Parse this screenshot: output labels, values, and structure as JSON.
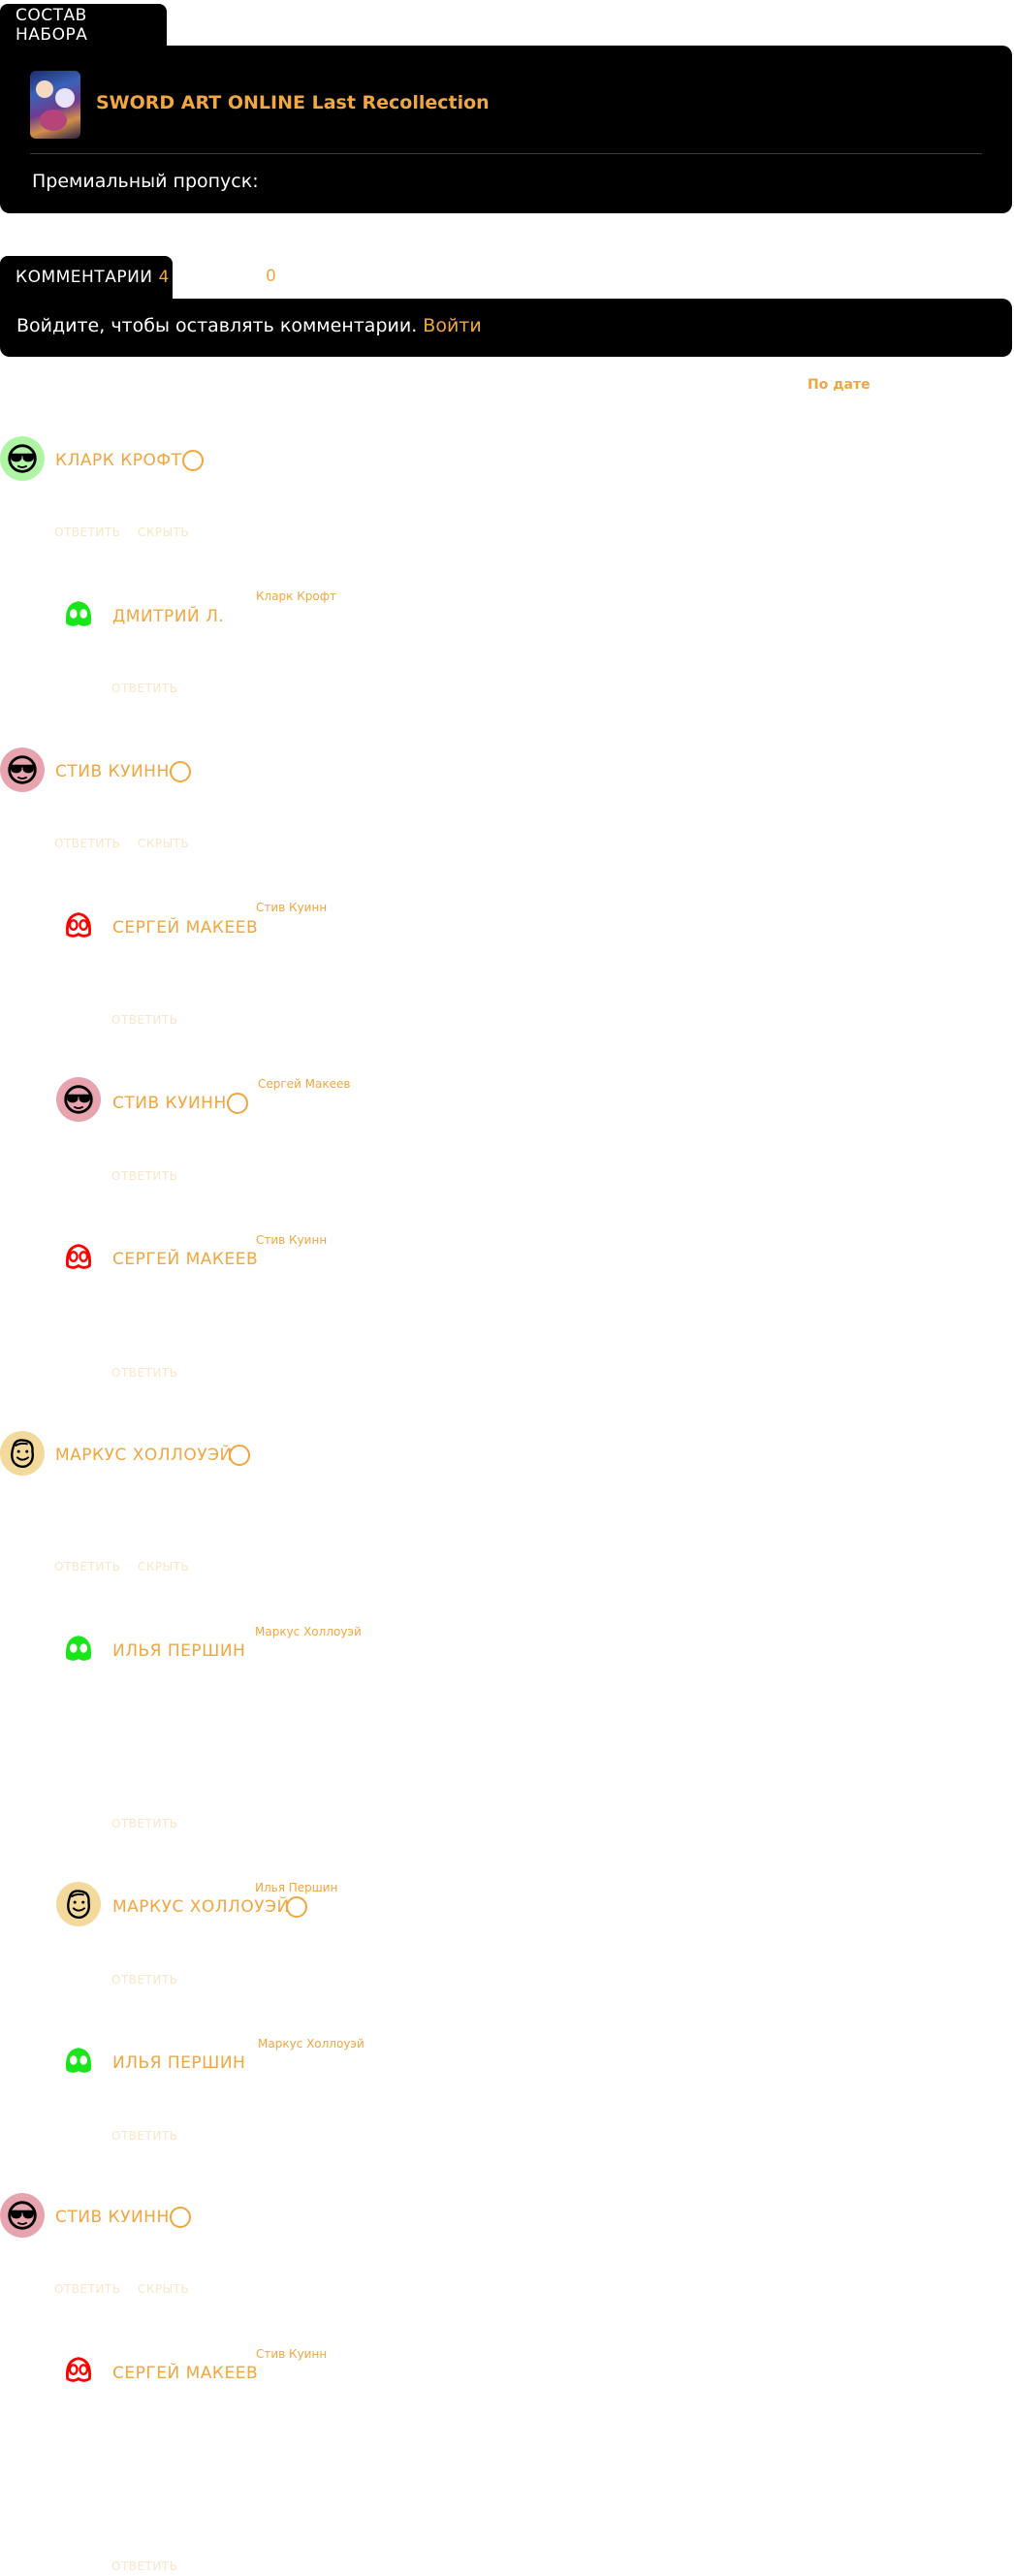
{
  "set": {
    "tab_label": "СОСТАВ НАБОРА",
    "game_title": "SWORD ART ONLINE Last Recollection",
    "premium_label": "Премиальный пропуск:"
  },
  "comments_section": {
    "tab_label": "КОММЕНТАРИИ",
    "count": "4",
    "likes": "0",
    "login_prompt": "Войдите, чтобы оставлять комментарии.",
    "login_link": "Войти",
    "sort_label": "По дате"
  },
  "actions": {
    "reply": "ОТВЕТИТЬ",
    "hide": "СКРЫТЬ"
  },
  "comments": [
    {
      "author": "КЛАРК КРОФТ"
    },
    {
      "author": "ДМИТРИЙ Л.",
      "reply_to": "Кларк Крофт"
    },
    {
      "author": "СТИВ КУИНН"
    },
    {
      "author": "СЕРГЕЙ МАКЕЕВ",
      "reply_to": "Стив Куинн"
    },
    {
      "author": "СТИВ КУИНН",
      "reply_to": "Сергей Макеев"
    },
    {
      "author": "СЕРГЕЙ МАКЕЕВ",
      "reply_to": "Стив Куинн"
    },
    {
      "author": "МАРКУС ХОЛЛОУЭЙ"
    },
    {
      "author": "ИЛЬЯ ПЕРШИН",
      "reply_to": "Маркус Холлоуэй"
    },
    {
      "author": "МАРКУС ХОЛЛОУЭЙ",
      "reply_to": "Илья Першин"
    },
    {
      "author": "ИЛЬЯ ПЕРШИН",
      "reply_to": "Маркус Холлоуэй"
    },
    {
      "author": "СТИВ КУИНН"
    },
    {
      "author": "СЕРГЕЙ МАКЕЕВ",
      "reply_to": "Стив Куинн"
    }
  ],
  "avatar_icons": {
    "steve": "sunglasses-face-icon",
    "sergey": "red-mask-face-icon",
    "green": "green-mask-face-icon",
    "markus": "bearded-face-icon"
  }
}
